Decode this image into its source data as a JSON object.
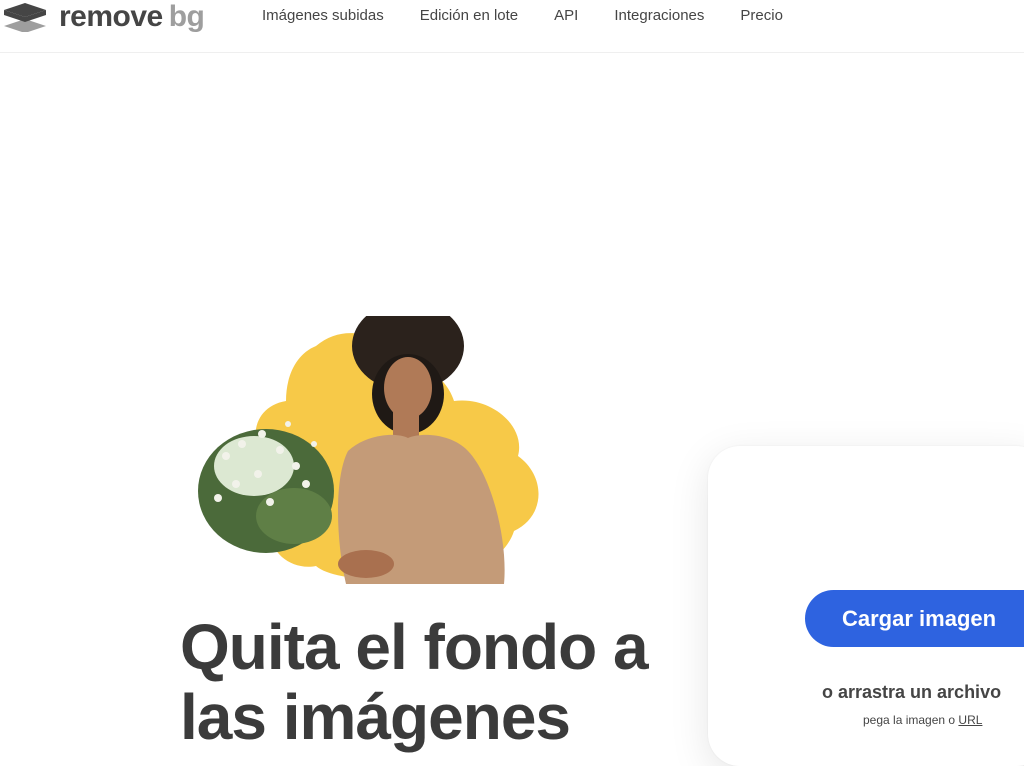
{
  "brand": {
    "word1": "remove",
    "word2": "bg",
    "colors": {
      "dark": "#454545",
      "light": "#9e9e9e"
    }
  },
  "nav": {
    "items": [
      {
        "label": "Imágenes subidas"
      },
      {
        "label": "Edición en lote"
      },
      {
        "label": "API"
      },
      {
        "label": "Integraciones"
      },
      {
        "label": "Precio"
      }
    ]
  },
  "hero": {
    "headline_line1": "Quita el fondo a",
    "headline_line2": "las imágenes",
    "art": {
      "blob_color": "#f7c948",
      "description_icon": "woman-with-flowers-photo"
    }
  },
  "upload": {
    "button_label": "Cargar imagen",
    "drop_text": "o arrastra un archivo",
    "paste_prefix": "pega la imagen o",
    "url_link": "URL",
    "accent": "#2e63e0"
  }
}
